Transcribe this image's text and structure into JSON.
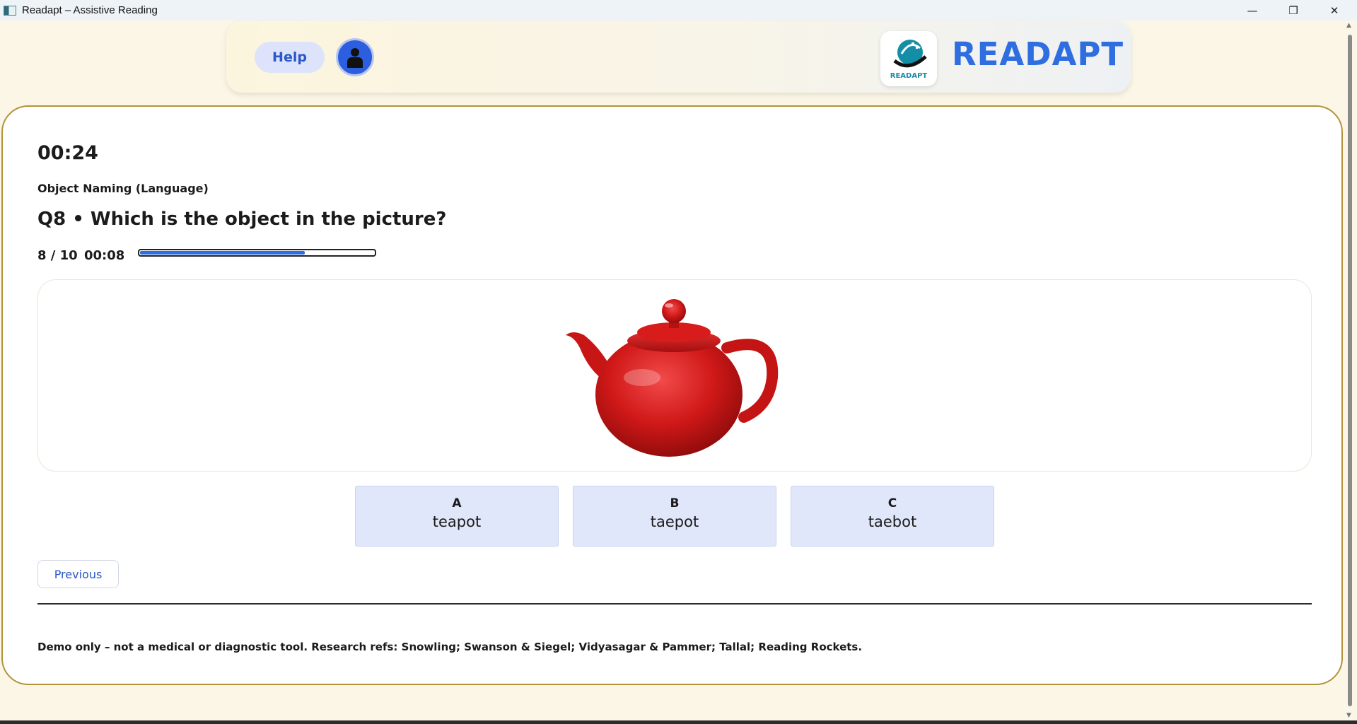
{
  "window": {
    "title": "Readapt – Assistive Reading",
    "controls": {
      "minimize": "—",
      "maximize": "❐",
      "close": "✕"
    }
  },
  "header": {
    "help_label": "Help",
    "profile_icon": "person-icon",
    "logo_text": "READAPT",
    "brand": "READAPT"
  },
  "quiz": {
    "timer": "00:24",
    "category": "Object Naming (Language)",
    "question": "Q8 • Which is the object in the picture?",
    "progress_count": "8 / 10",
    "progress_time": "00:08",
    "progress_fraction": 0.7,
    "image_icon": "red-teapot-image",
    "options": [
      {
        "letter": "A",
        "word": "teapot"
      },
      {
        "letter": "B",
        "word": "taepot"
      },
      {
        "letter": "C",
        "word": "taebot"
      }
    ],
    "previous_label": "Previous"
  },
  "footer": {
    "note": "Demo only – not a medical or diagnostic tool. Research refs: Snowling; Swanson & Siegel; Vidyasagar & Pammer; Tallal; Reading Rockets."
  },
  "colors": {
    "accent": "#2f6ee0",
    "page_bg": "#fcf6e6",
    "card_border": "#b2923a",
    "option_bg": "#e0e7fb",
    "teapot": "#d01818"
  }
}
